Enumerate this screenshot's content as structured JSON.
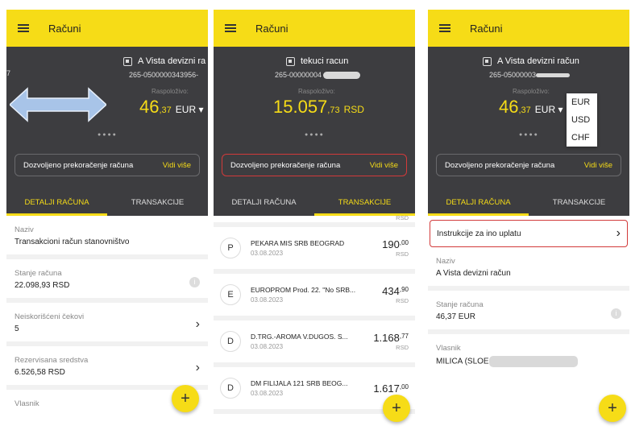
{
  "screens": [
    {
      "appbar_title": "Računi",
      "account_title": "A Vista devizni ra",
      "account_number": "265-0500000343956-",
      "left_edge_digit": "7",
      "available_label": "Raspoloživo:",
      "amount_int": "46",
      "amount_dec": ",37",
      "currency": "EUR ▾",
      "overdraft_label": "Dozvoljeno prekoračenje računa",
      "overdraft_link": "Vidi više",
      "tab_details": "DETALJI RAČUNA",
      "tab_transactions": "TRANSAKCIJE",
      "fields": [
        {
          "label": "Naziv",
          "value": "Transakcioni račun stanovništvo"
        },
        {
          "label": "Stanje računa",
          "value": "22.098,93 RSD"
        },
        {
          "label": "Neiskorišćeni čekovi",
          "value": "5"
        },
        {
          "label": "Rezervisana sredstva",
          "value": "6.526,58 RSD"
        },
        {
          "label": "Vlasnik",
          "value": ""
        }
      ],
      "fab": "+"
    },
    {
      "appbar_title": "Računi",
      "account_title": "tekuci racun",
      "account_number": "265-00000004",
      "available_label": "Raspoloživo:",
      "amount_int": "15.057",
      "amount_dec": ",73",
      "currency": "RSD",
      "overdraft_label": "Dozvoljeno prekoračenje računa",
      "overdraft_link": "Vidi više",
      "tab_details": "DETALJI RAČUNA",
      "tab_transactions": "TRANSAKCIJE",
      "top_partial_currency": "RSD",
      "transactions": [
        {
          "avatar": "P",
          "name": "PEKARA MIS SRB BEOGRAD",
          "date": "03.08.2023",
          "amount": "190",
          "dec": ",00",
          "currency": "RSD"
        },
        {
          "avatar": "E",
          "name": "EUROPROM Prod. 22. \"No SRB...",
          "date": "03.08.2023",
          "amount": "434",
          "dec": ",90",
          "currency": "RSD"
        },
        {
          "avatar": "D",
          "name": "D.TRG.-AROMA V.DUGOS. S...",
          "date": "03.08.2023",
          "amount": "1.168",
          "dec": ",77",
          "currency": "RSD"
        },
        {
          "avatar": "D",
          "name": "DM FILIJALA 121 SRB BEOG...",
          "date": "03.08.2023",
          "amount": "1.617",
          "dec": ",00",
          "currency": ""
        }
      ],
      "fab": "+"
    },
    {
      "appbar_title": "Računi",
      "account_title": "A Vista devizni račun",
      "account_number": "265-05000003",
      "available_label": "Raspoloživo:",
      "amount_int": "46",
      "amount_dec": ",37",
      "currency": "EUR ▾",
      "currency_options": [
        "EUR",
        "USD",
        "CHF"
      ],
      "overdraft_label": "Dozvoljeno prekoračenje računa",
      "overdraft_link": "Vidi više",
      "tab_details": "DETALJI RAČUNA",
      "tab_transactions": "TRANSAKCIJE",
      "instruction_label": "Instrukcije za ino uplatu",
      "fields": [
        {
          "label": "Naziv",
          "value": "A Vista devizni račun"
        },
        {
          "label": "Stanje računa",
          "value": "46,37 EUR"
        },
        {
          "label": "Vlasnik",
          "value": "MILICA (SLOE"
        }
      ],
      "fab": "+"
    }
  ],
  "colors": {
    "brand_yellow": "#f6dc17",
    "header_dark": "#3d3d40",
    "highlight_red": "#d23a3a",
    "swipe_arrow": "#a8c4e8"
  }
}
